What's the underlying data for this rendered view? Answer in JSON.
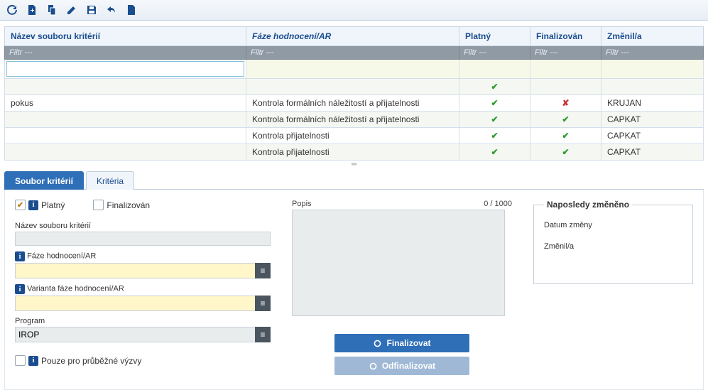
{
  "toolbar": {
    "icons": [
      "refresh",
      "new",
      "copy",
      "edit",
      "save",
      "undo",
      "document"
    ]
  },
  "grid": {
    "headers": {
      "name": "Název souboru kritérií",
      "phase": "Fáze hodnocení/AR",
      "valid": "Platný",
      "finalized": "Finalizován",
      "changed_by": "Změnil/a"
    },
    "filter_placeholder": "Filtr ---",
    "rows": [
      {
        "name": "",
        "phase": "",
        "valid": "green",
        "finalized": "",
        "by": ""
      },
      {
        "name": "pokus",
        "phase": "Kontrola formálních náležitostí a přijatelnosti",
        "valid": "green",
        "finalized": "red",
        "by": "KRUJAN"
      },
      {
        "name": "",
        "phase": "Kontrola formálních náležitostí a přijatelnosti",
        "valid": "green",
        "finalized": "green",
        "by": "CAPKAT"
      },
      {
        "name": "",
        "phase": "Kontrola přijatelnosti",
        "valid": "green",
        "finalized": "green",
        "by": "CAPKAT"
      },
      {
        "name": "",
        "phase": "Kontrola přijatelnosti",
        "valid": "green",
        "finalized": "green",
        "by": "CAPKAT"
      }
    ]
  },
  "tabs": {
    "active": "Soubor kritérií",
    "inactive": "Kritéria"
  },
  "form": {
    "valid_label": "Platný",
    "valid_checked": true,
    "finalized_label": "Finalizován",
    "finalized_checked": false,
    "name_label": "Název souboru kritérií",
    "name_value": "",
    "phase_label": "Fáze hodnocení/AR",
    "phase_value": "",
    "variant_label": "Varianta fáze hodnocení/AR",
    "variant_value": "",
    "program_label": "Program",
    "program_value": "IROP",
    "only_continuous_label": "Pouze pro průběžné výzvy",
    "only_continuous_checked": false,
    "popis_label": "Popis",
    "popis_counter": "0 / 1000",
    "popis_value": "",
    "btn_finalize": "Finalizovat",
    "btn_unfinalize": "Odfinalizovat",
    "changes_legend": "Naposledy změněno",
    "date_label": "Datum změny",
    "by_label": "Změnil/a"
  }
}
